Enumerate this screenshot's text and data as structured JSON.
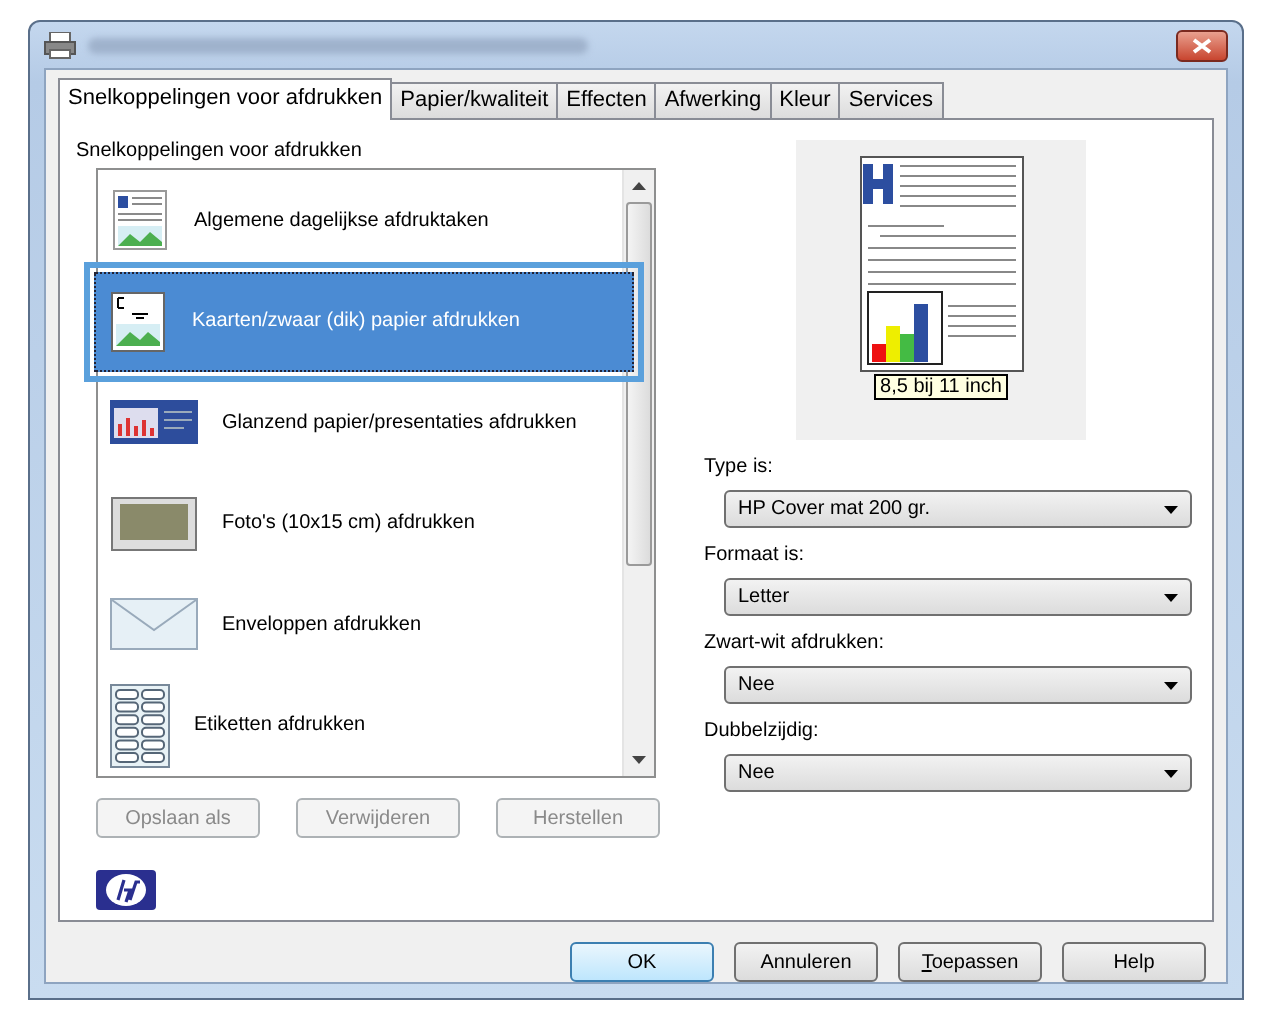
{
  "tabs": [
    {
      "label": "Snelkoppelingen voor afdrukken",
      "selected": true
    },
    {
      "label": "Papier/kwaliteit",
      "selected": false
    },
    {
      "label": "Effecten",
      "selected": false
    },
    {
      "label": "Afwerking",
      "selected": false
    },
    {
      "label": "Kleur",
      "selected": false
    },
    {
      "label": "Services",
      "selected": false
    }
  ],
  "shortcuts": {
    "label": "Snelkoppelingen voor afdrukken",
    "items": [
      {
        "kind": "document",
        "label": "Algemene dagelijkse afdruktaken",
        "selected": false
      },
      {
        "kind": "card",
        "label": "Kaarten/zwaar (dik) papier afdrukken",
        "selected": true
      },
      {
        "kind": "presentation",
        "label": "Glanzend papier/presentaties afdrukken",
        "selected": false
      },
      {
        "kind": "photo",
        "label": "Foto's (10x15 cm) afdrukken",
        "selected": false
      },
      {
        "kind": "envelope",
        "label": "Enveloppen afdrukken",
        "selected": false
      },
      {
        "kind": "labels",
        "label": "Etiketten afdrukken",
        "selected": false
      }
    ],
    "buttons": [
      {
        "label": "Opslaan als",
        "disabled": true
      },
      {
        "label": "Verwijderen",
        "disabled": true
      },
      {
        "label": "Herstellen",
        "disabled": true
      }
    ]
  },
  "preview": {
    "size": "8,5 bij 11 inch"
  },
  "settings": [
    {
      "label": "Type is:",
      "value": "HP Cover mat 200 gr."
    },
    {
      "label": "Formaat is:",
      "value": "Letter"
    },
    {
      "label": "Zwart-wit afdrukken:",
      "value": "Nee"
    },
    {
      "label": "Dubbelzijdig:",
      "value": "Nee"
    }
  ],
  "dialog_buttons": [
    {
      "label": "OK",
      "default": true
    },
    {
      "label": "Annuleren",
      "default": false
    },
    {
      "label": "Toepassen",
      "default": false
    },
    {
      "label": "Help",
      "default": false
    }
  ]
}
